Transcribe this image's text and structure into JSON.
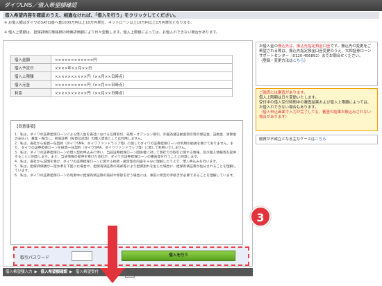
{
  "header": {
    "title": "ダイワLMS／借入希望額確認"
  },
  "instruction": "借入希望内容を確認のうえ、相違なければ、「借入を行う」をクリックしてください。",
  "notes": [
    "※ お借入額はダイワのSAT口座へ直1000万円以上10万円単位、ネットローン以上10万円以上1万円単位となります。",
    "※ 借入上限額は、担保評価対象銘柄の時価評価額により日々変動します。借入上限額によっては、お借入れできない場合があります。"
  ],
  "summary": {
    "rows": [
      {
        "label": "借入金額",
        "value": "××××××××××××円"
      },
      {
        "label": "借入予定日",
        "value": "××××年××月××日"
      },
      {
        "label": "借入上限額",
        "value": "××××××××××円（××月××日時点）"
      },
      {
        "label": "借入元金",
        "value": "××××××××××円（××月××日時点）"
      },
      {
        "label": "利息",
        "value": "××××××××××円（××月××日時点）"
      }
    ]
  },
  "terms": {
    "title": "【同意事項】",
    "paragraphs": [
      "1．私は、ダイワの証券担保ローンによる借入金を貴社における信用取引、先物・オプション取引、外国為替証拠金取引等の保証金、証拠金、清算金の支払い、募集・売出し、有価証券（投資信託等）の購入資金としては利用しません。",
      "2．私は、貴社から投資一任契約（ダイワSMA、ダイワファンドラップ等）に関してダイワの証券担保ローンの利用の勧誘を受けておりません。また、ダイワの証券担保ローンを投資一任契約（ダイワSMA、ダイワファンドラップ等）に関して利用いたしません。",
      "3．私は、ダイワの証券担保ローンの借入契約申込みに伴い、当該証券担保ローン関係者に対して弊社での取引に関する情報、及び個人情報等を提供することに同意します。また、当該情報の提供を受けた会社が、ダイワの証券担保ローンの審査等を行うことに同意します。",
      "4．私は、貴社から説明を受け、ダイワの証券担保ローンに関する約款・規定等の内容を十分に理解したうえで、借入申込みを行います。",
      "5．私は、担保評価額が一定水準を下回った場合や、担保有価証券の売却等により担保割れを生じた場合に、担保有価証券が処分されることを理解しています。",
      "6．私は、ダイワの証券担保ローンの利用中に担保有価証券の売却や移管を行う場合には、事前に所定の手続きが必要であることを理解しています。"
    ]
  },
  "form": {
    "password_label": "取引パスワード",
    "password_value": "",
    "submit_label": "借入を行う",
    "back_label": "戻る"
  },
  "callout": {
    "number": "3"
  },
  "steps": [
    {
      "label": "借入希望額入力",
      "active": false
    },
    {
      "label": "借入希望額確認",
      "active": true
    },
    {
      "label": "借入希望受付",
      "active": false
    }
  ],
  "side": {
    "box1": {
      "text_before": "お借入金の",
      "highlight": "振込先は、振込先指定預金口座",
      "text_after": "です。振込先の変更をご希望される際は、振込先指定預金口座変更のうえ、大和証券ローンサポートセンター（0120-456892）までお問合せください。",
      "link_prefix": "（登録・変更方法は",
      "link_text": "こちら",
      "link_suffix": "）"
    },
    "box2": {
      "lines": [
        "ご融資には審査があります。",
        "借入上限額は日々変動いたします。",
        "受付中の借入受付時間中の審査結果および借入上限額によっては、お借入れできない場合もあります。",
        "（借入申込画面で入力が完了しても、審査の結果お振込みされない場合があります）"
      ]
    },
    "box3": {
      "text": "融資が不成立となる主なケースは",
      "link_text": "こちら"
    }
  },
  "colors": {
    "accent": "#e2343c",
    "button_green": "#6fb72e",
    "header_bg": "#4a4a4a",
    "warn_bg": "#fff6cc"
  }
}
